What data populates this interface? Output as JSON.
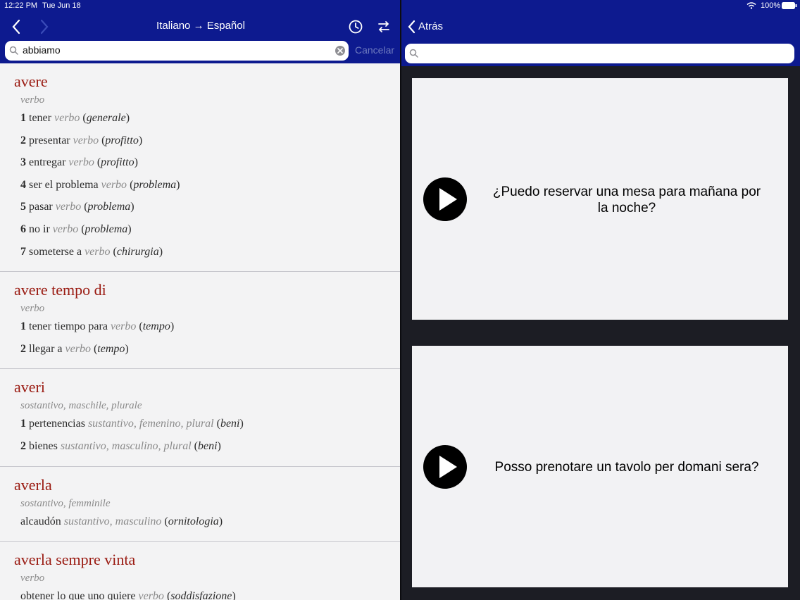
{
  "status": {
    "time": "12:22 PM",
    "date": "Tue Jun 18",
    "battery": "100%"
  },
  "left": {
    "title": "Italiano → Español",
    "search_value": "abbiamo",
    "cancel_label": "Cancelar",
    "entries": [
      {
        "head": "avere",
        "pos": "verbo",
        "senses": [
          {
            "num": "1",
            "text": "tener",
            "gp": "verbo",
            "ctx": "generale"
          },
          {
            "num": "2",
            "text": "presentar",
            "gp": "verbo",
            "ctx": "profitto"
          },
          {
            "num": "3",
            "text": "entregar",
            "gp": "verbo",
            "ctx": "profitto"
          },
          {
            "num": "4",
            "text": "ser el problema",
            "gp": "verbo",
            "ctx": "problema"
          },
          {
            "num": "5",
            "text": "pasar",
            "gp": "verbo",
            "ctx": "problema"
          },
          {
            "num": "6",
            "text": "no ir",
            "gp": "verbo",
            "ctx": "problema"
          },
          {
            "num": "7",
            "text": "someterse a",
            "gp": "verbo",
            "ctx": "chirurgia"
          }
        ]
      },
      {
        "head": "avere tempo di",
        "pos": "verbo",
        "senses": [
          {
            "num": "1",
            "text": "tener tiempo para",
            "gp": "verbo",
            "ctx": "tempo"
          },
          {
            "num": "2",
            "text": "llegar a",
            "gp": "verbo",
            "ctx": "tempo"
          }
        ]
      },
      {
        "head": "averi",
        "pos": "sostantivo, maschile, plurale",
        "senses": [
          {
            "num": "1",
            "text": "pertenencias",
            "gp": "sustantivo, femenino, plural",
            "ctx": "beni"
          },
          {
            "num": "2",
            "text": "bienes",
            "gp": "sustantivo, masculino, plural",
            "ctx": "beni"
          }
        ]
      },
      {
        "head": "averla",
        "pos": "sostantivo, femminile",
        "senses": [
          {
            "num": "",
            "text": "alcaudón",
            "gp": "sustantivo, masculino",
            "ctx": "ornitologia"
          }
        ]
      },
      {
        "head": "averla sempre vinta",
        "pos": "verbo",
        "senses": [
          {
            "num": "",
            "text": "obtener lo que uno quiere",
            "gp": "verbo",
            "ctx": "soddisfazione"
          }
        ]
      }
    ]
  },
  "right": {
    "back_label": "Atrás",
    "cards": [
      {
        "phrase": "¿Puedo reservar una mesa para mañana por la noche?"
      },
      {
        "phrase": "Posso prenotare un tavolo per domani sera?"
      }
    ]
  },
  "colors": {
    "navbar": "#0d1a8f",
    "headword": "#9a1b12",
    "background": "#f3f3f4"
  },
  "icons": [
    "back-chevron-icon",
    "forward-chevron-icon",
    "history-clock-icon",
    "swap-direction-icon",
    "search-icon",
    "clear-icon",
    "play-icon",
    "wifi-icon",
    "battery-icon"
  ]
}
